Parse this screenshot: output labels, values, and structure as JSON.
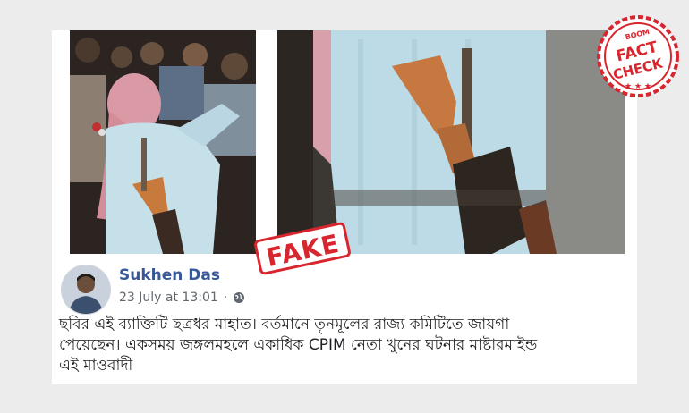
{
  "post": {
    "author": "Sukhen Das",
    "date": "23 July at 13:01",
    "separator": "·",
    "privacy_icon": "globe-icon",
    "text_lines": [
      "ছবির এই ব্যাক্তিটি ছত্রধর মাহাত। বর্তমানে তৃনমূলের রাজ্য কমিটিতে জায়গা",
      "পেয়েছেন। একসময় জঙ্গলমহলে একাধিক CPIM নেতা খুনের ঘটনার মাষ্টারমাইন্ড",
      "এই মাওবাদী"
    ]
  },
  "stamp": {
    "fake_label": "FAKE"
  },
  "badge": {
    "brand": "BOOM",
    "line1": "FACT",
    "line2": "CHECK",
    "color": "#d8262e"
  },
  "colors": {
    "author": "#385898",
    "meta": "#616770",
    "text": "#1c1e21",
    "stamp": "#d8262e"
  }
}
